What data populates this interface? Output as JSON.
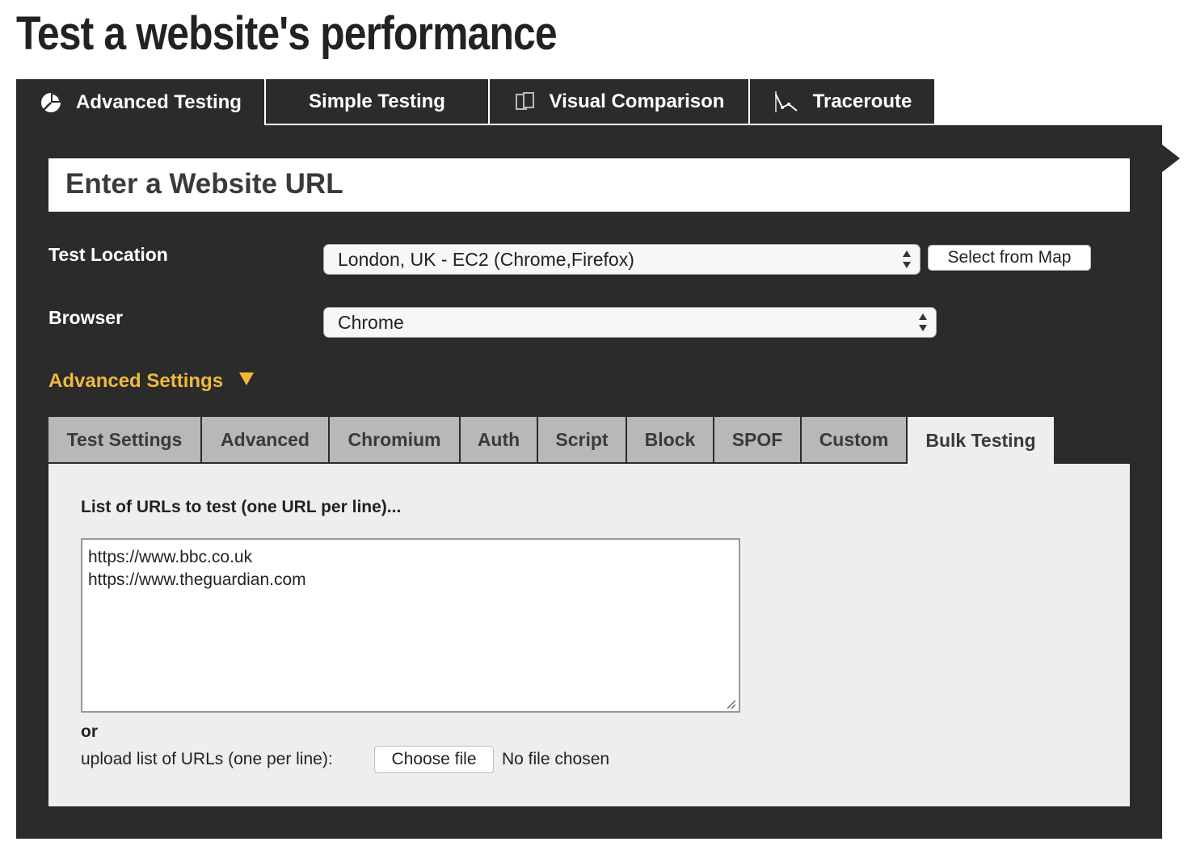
{
  "page": {
    "title": "Test a website's performance"
  },
  "main_tabs": [
    {
      "label": "Advanced Testing",
      "icon": "chart-pie-icon",
      "active": true
    },
    {
      "label": "Simple Testing",
      "icon": "",
      "active": false
    },
    {
      "label": "Visual Comparison",
      "icon": "pages-compare-icon",
      "active": false
    },
    {
      "label": "Traceroute",
      "icon": "traceroute-icon",
      "active": false
    }
  ],
  "url_section": {
    "heading": "Enter a Website URL"
  },
  "test_location": {
    "label": "Test Location",
    "selected": "London, UK - EC2 (Chrome,Firefox)",
    "map_button": "Select from Map"
  },
  "browser": {
    "label": "Browser",
    "selected": "Chrome"
  },
  "advanced_settings": {
    "label": "Advanced Settings"
  },
  "sub_tabs": [
    {
      "label": "Test Settings",
      "active": false
    },
    {
      "label": "Advanced",
      "active": false
    },
    {
      "label": "Chromium",
      "active": false
    },
    {
      "label": "Auth",
      "active": false
    },
    {
      "label": "Script",
      "active": false
    },
    {
      "label": "Block",
      "active": false
    },
    {
      "label": "SPOF",
      "active": false
    },
    {
      "label": "Custom",
      "active": false
    },
    {
      "label": "Bulk Testing",
      "active": true
    }
  ],
  "bulk": {
    "list_label": "List of URLs to test (one URL per line)...",
    "urls": "https://www.bbc.co.uk\nhttps://www.theguardian.com",
    "or_text": "or",
    "upload_label": "upload list of URLs (one per line):",
    "choose_button": "Choose file",
    "file_status": "No file chosen"
  },
  "colors": {
    "panel_bg": "#2b2b2b",
    "accent": "#f1b93a",
    "subtab_bg": "#b8b8b8",
    "subpanel_bg": "#eeeeee"
  }
}
